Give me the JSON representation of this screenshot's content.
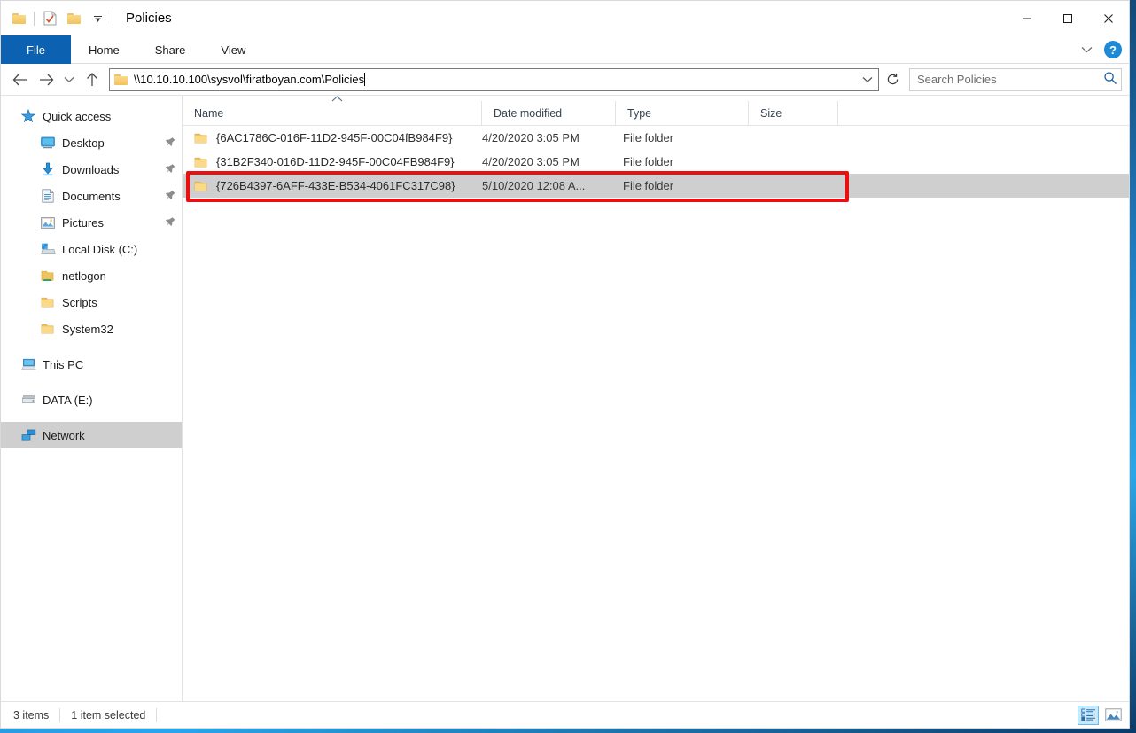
{
  "window": {
    "title": "Policies",
    "quick_access_toolbar": [
      {
        "name": "folder-icon",
        "label": ""
      },
      {
        "name": "properties-icon",
        "label": ""
      },
      {
        "name": "new-folder-icon",
        "label": ""
      },
      {
        "name": "chevron-down-icon",
        "label": ""
      }
    ],
    "controls": {
      "minimize": "—",
      "maximize": "☐",
      "close": "✕"
    }
  },
  "ribbon": {
    "tabs": [
      {
        "label": "File",
        "active": true
      },
      {
        "label": "Home",
        "active": false
      },
      {
        "label": "Share",
        "active": false
      },
      {
        "label": "View",
        "active": false
      }
    ],
    "collapse_icon": "⌄",
    "help_label": "?"
  },
  "navigation": {
    "back": "←",
    "forward": "→",
    "recent": "⌄",
    "up": "↑",
    "refresh": "↻"
  },
  "address": {
    "path": "\\\\10.10.10.100\\sysvol\\firatboyan.com\\Policies",
    "dropdown_icon": "⌄"
  },
  "search": {
    "placeholder": "Search Policies",
    "value": "",
    "icon": "search-icon"
  },
  "sidebar": {
    "items": [
      {
        "label": "Quick access",
        "icon": "star-icon",
        "indent": 0,
        "pinned": false,
        "selected": false
      },
      {
        "label": "Desktop",
        "icon": "desktop-icon",
        "indent": 1,
        "pinned": true,
        "selected": false
      },
      {
        "label": "Downloads",
        "icon": "download-icon",
        "indent": 1,
        "pinned": true,
        "selected": false
      },
      {
        "label": "Documents",
        "icon": "document-icon",
        "indent": 1,
        "pinned": true,
        "selected": false
      },
      {
        "label": "Pictures",
        "icon": "picture-icon",
        "indent": 1,
        "pinned": true,
        "selected": false
      },
      {
        "label": "Local Disk (C:)",
        "icon": "windows-disk-icon",
        "indent": 1,
        "pinned": false,
        "selected": false
      },
      {
        "label": "netlogon",
        "icon": "network-folder-icon",
        "indent": 1,
        "pinned": false,
        "selected": false
      },
      {
        "label": "Scripts",
        "icon": "folder-icon",
        "indent": 1,
        "pinned": false,
        "selected": false
      },
      {
        "label": "System32",
        "icon": "folder-icon",
        "indent": 1,
        "pinned": false,
        "selected": false
      },
      {
        "label": "This PC",
        "icon": "this-pc-icon",
        "indent": 0,
        "pinned": false,
        "selected": false
      },
      {
        "label": "DATA (E:)",
        "icon": "drive-icon",
        "indent": 0,
        "pinned": false,
        "selected": false
      },
      {
        "label": "Network",
        "icon": "network-icon",
        "indent": 0,
        "pinned": false,
        "selected": true
      }
    ]
  },
  "file_list": {
    "columns": [
      {
        "label": "Name",
        "sorted": "ascending"
      },
      {
        "label": "Date modified",
        "sorted": ""
      },
      {
        "label": "Type",
        "sorted": ""
      },
      {
        "label": "Size",
        "sorted": ""
      }
    ],
    "sort_indicator": "˄",
    "rows": [
      {
        "name": "{6AC1786C-016F-11D2-945F-00C04fB984F9}",
        "date_modified": "4/20/2020 3:05 PM",
        "type": "File folder",
        "size": "",
        "selected": false,
        "icon": "folder-icon"
      },
      {
        "name": "{31B2F340-016D-11D2-945F-00C04FB984F9}",
        "date_modified": "4/20/2020 3:05 PM",
        "type": "File folder",
        "size": "",
        "selected": false,
        "icon": "folder-icon"
      },
      {
        "name": "{726B4397-6AFF-433E-B534-4061FC317C98}",
        "date_modified": "5/10/2020 12:08 A...",
        "type": "File folder",
        "size": "",
        "selected": true,
        "icon": "folder-icon"
      }
    ]
  },
  "annotation": {
    "color": "#e81010",
    "target_row_index": 2
  },
  "status": {
    "item_count": "3 items",
    "selection": "1 item selected",
    "view_buttons": [
      {
        "name": "details-view",
        "active": true
      },
      {
        "name": "large-icons-view",
        "active": false
      }
    ]
  },
  "colors": {
    "accent": "#0c62b0",
    "selection": "#cfcfcf",
    "annotation": "#e81010",
    "folder": "#f2c35c"
  }
}
